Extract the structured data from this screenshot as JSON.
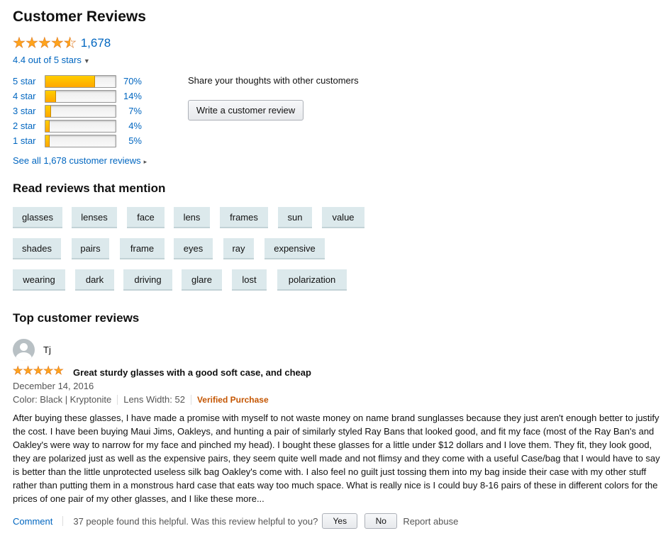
{
  "title": "Customer Reviews",
  "rating_count": "1,678",
  "rating_value": 4.4,
  "rating_text": "4.4 out of 5 stars",
  "histogram": [
    {
      "label": "5 star",
      "percent": 70,
      "percent_text": "70%"
    },
    {
      "label": "4 star",
      "percent": 14,
      "percent_text": "14%"
    },
    {
      "label": "3 star",
      "percent": 7,
      "percent_text": "7%"
    },
    {
      "label": "2 star",
      "percent": 4,
      "percent_text": "4%"
    },
    {
      "label": "1 star",
      "percent": 5,
      "percent_text": "5%"
    }
  ],
  "see_all": "See all 1,678 customer reviews",
  "share_text": "Share your thoughts with other customers",
  "write_review_label": "Write a customer review",
  "mentions_heading": "Read reviews that mention",
  "mentions": [
    [
      "glasses",
      "lenses",
      "face",
      "lens",
      "frames",
      "sun",
      "value"
    ],
    [
      "shades",
      "pairs",
      "frame",
      "eyes",
      "ray",
      "expensive"
    ],
    [
      "wearing",
      "dark",
      "driving",
      "glare",
      "lost",
      "polarization"
    ]
  ],
  "top_reviews_heading": "Top customer reviews",
  "review": {
    "author": "Tj",
    "stars": 5,
    "title": "Great sturdy glasses with a good soft case, and cheap",
    "date": "December 14, 2016",
    "color": "Color: Black | Kryptonite",
    "lens_width": "Lens Width: 52",
    "verified": "Verified Purchase",
    "body": "After buying these glasses, I have made a promise with myself to not waste money on name brand sunglasses because they just aren't enough better to justify the cost. I have been buying Maui Jims, Oakleys, and hunting a pair of similarly styled Ray Bans that looked good, and fit my face (most of the Ray Ban's and Oakley's were way to narrow for my face and pinched my head). I bought these glasses for a little under $12 dollars and I love them. They fit, they look good, they are polarized just as well as the expensive pairs, they seem quite well made and not flimsy and they come with a useful Case/bag that I would have to say is better than the little unprotected useless silk bag Oakley's come with. I also feel no guilt just tossing them into my bag inside their case with my other stuff rather than putting them in a monstrous hard case that eats way too much space. What is really nice is I could buy 8-16 pairs of these in different colors for the prices of one pair of my other glasses, and I like these more...",
    "comment_label": "Comment",
    "helpful_text": "37 people found this helpful. Was this review helpful to you?",
    "yes_label": "Yes",
    "no_label": "No",
    "report_label": "Report abuse"
  },
  "colors": {
    "star": "#ffa41c",
    "link": "#0066c0",
    "verified": "#c45500",
    "chip": "#dce9ec"
  }
}
